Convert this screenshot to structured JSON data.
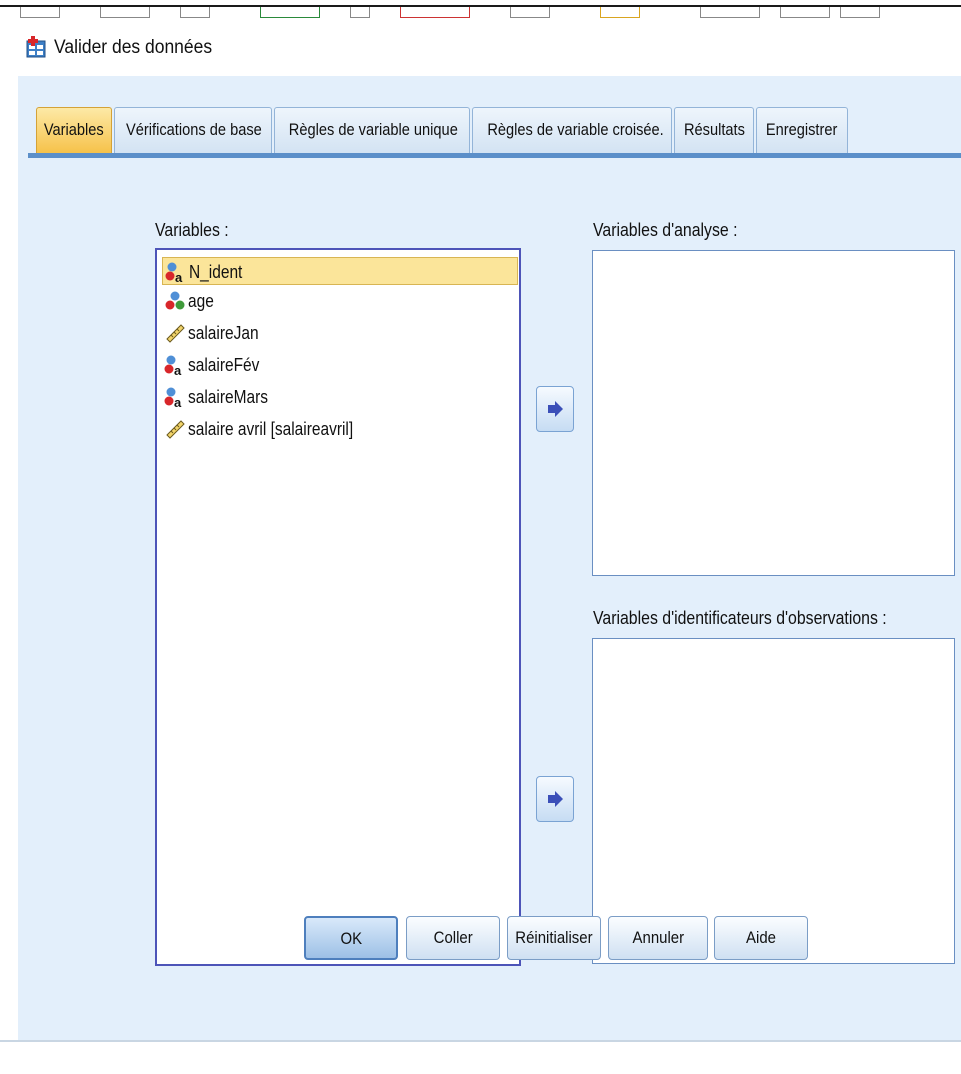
{
  "window": {
    "title": "Valider des données"
  },
  "tabs": [
    {
      "label": "Variables",
      "active": true
    },
    {
      "label": "Vérifications de base",
      "active": false
    },
    {
      "label": "Règles de variable unique",
      "active": false
    },
    {
      "label": "Règles de variable croisée.",
      "active": false
    },
    {
      "label": "Résultats",
      "active": false
    },
    {
      "label": "Enregistrer",
      "active": false
    }
  ],
  "source": {
    "label": "Variables :",
    "items": [
      {
        "name": "N_ident",
        "icon": "nominal-string-icon",
        "selected": true
      },
      {
        "name": "age",
        "icon": "nominal-icon",
        "selected": false
      },
      {
        "name": "salaireJan",
        "icon": "scale-ruler-icon",
        "selected": false
      },
      {
        "name": "salaireFév",
        "icon": "nominal-string-icon",
        "selected": false
      },
      {
        "name": "salaireMars",
        "icon": "nominal-string-icon",
        "selected": false
      },
      {
        "name": "salaire avril [salaireavril]",
        "icon": "scale-ruler-icon",
        "selected": false
      }
    ]
  },
  "analysis": {
    "label": "Variables d'analyse :"
  },
  "case_id": {
    "label": "Variables d'identificateurs d'observations :"
  },
  "buttons": {
    "ok": "OK",
    "paste": "Coller",
    "reset": "Réinitialiser",
    "cancel": "Annuler",
    "help": "Aide"
  },
  "colors": {
    "dialog_bg": "#e3effb",
    "tab_active": "#f6c24a",
    "tab_bar": "#5b8fc9",
    "selection": "#fbe59a",
    "list_border": "#4d54b8"
  }
}
